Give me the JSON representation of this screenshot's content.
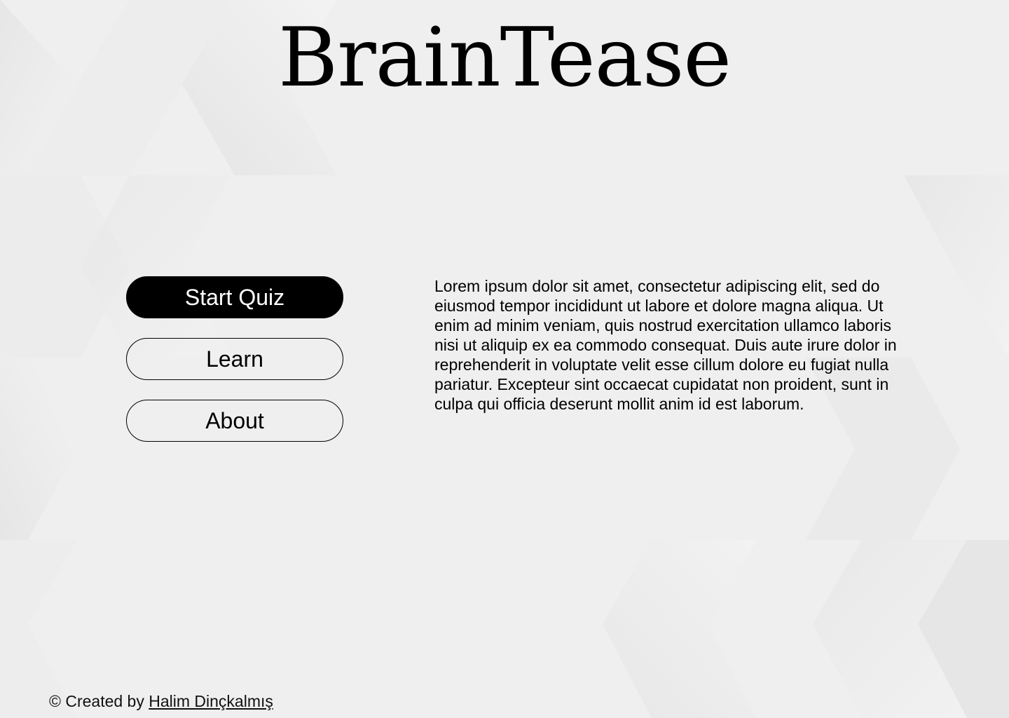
{
  "header": {
    "title": "BrainTease"
  },
  "menu": {
    "start_quiz_label": "Start Quiz",
    "learn_label": "Learn",
    "about_label": "About"
  },
  "main": {
    "description": "Lorem ipsum dolor sit amet, consectetur adipiscing elit, sed do eiusmod tempor incididunt ut labore et dolore magna aliqua. Ut enim ad minim veniam, quis nostrud exercitation ullamco laboris nisi ut aliquip ex ea commodo consequat. Duis aute irure dolor in reprehenderit in voluptate velit esse cillum dolore eu fugiat nulla pariatur. Excepteur sint occaecat cupidatat non proident, sunt in culpa qui officia deserunt mollit anim id est laborum."
  },
  "footer": {
    "prefix": "© Created by",
    "author_link": "Halim Dinçkalmış"
  },
  "colors": {
    "background": "#efefef",
    "primary_button_bg": "#000000",
    "primary_button_text": "#ffffff",
    "text": "#000000"
  }
}
